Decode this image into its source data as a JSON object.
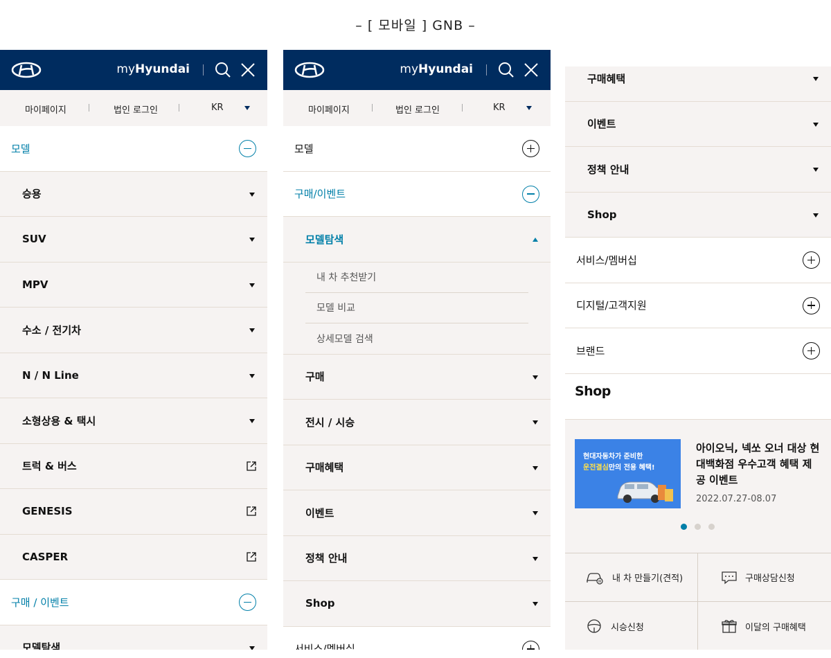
{
  "page_title": "– [ 모바일 ] GNB –",
  "header": {
    "brand_my": "my",
    "brand_name": "Hyundai",
    "subnav": [
      "마이페이지",
      "법인 로그인",
      "KR"
    ]
  },
  "panel1": {
    "section_model": "모델",
    "models": [
      "승용",
      "SUV",
      "MPV",
      "수소 / 전기차",
      "N / N Line",
      "소형상용 & 택시",
      "트럭 & 버스",
      "GENESIS",
      "CASPER"
    ],
    "section_buy": "구매  / 이벤트",
    "bottom_partial": "모델탐색"
  },
  "panel2": {
    "section_model": "모델",
    "section_buy": "구매/이벤트",
    "explore": "모델탐색",
    "explore_items": [
      "내 차 추천받기",
      "모델 비교",
      "상세모델 검색"
    ],
    "buy_items": [
      "구매",
      "전시 / 시승",
      "구매혜택",
      "이벤트",
      "정책 안내",
      "Shop"
    ],
    "bottom_partial": "서비스/멤버십"
  },
  "panel3": {
    "buy_items": [
      "구매혜택",
      "이벤트",
      "정책 안내",
      "Shop"
    ],
    "sections": [
      "서비스/멤버십",
      "디지털/고객지원",
      "브랜드"
    ],
    "shop_logo": "Shop",
    "promo": {
      "image_line1": "현대자동차가 준비한",
      "image_line2_highlight": "운전결심",
      "image_line2_rest": "만의 전용 혜택!",
      "title": "아이오닉, 넥쏘 오너 대상 현대백화점 우수고객 혜택 제공 이벤트",
      "date": "2022.07.27-08.07"
    },
    "carousel": {
      "total": 3,
      "active": 1
    },
    "quick_links": [
      "내 차 만들기(견적)",
      "구매상담신청",
      "시승신청",
      "이달의 구매혜택"
    ]
  },
  "colors": {
    "navy": "#002c5f",
    "accent": "#007fa8",
    "beige": "#f6f3f2"
  }
}
